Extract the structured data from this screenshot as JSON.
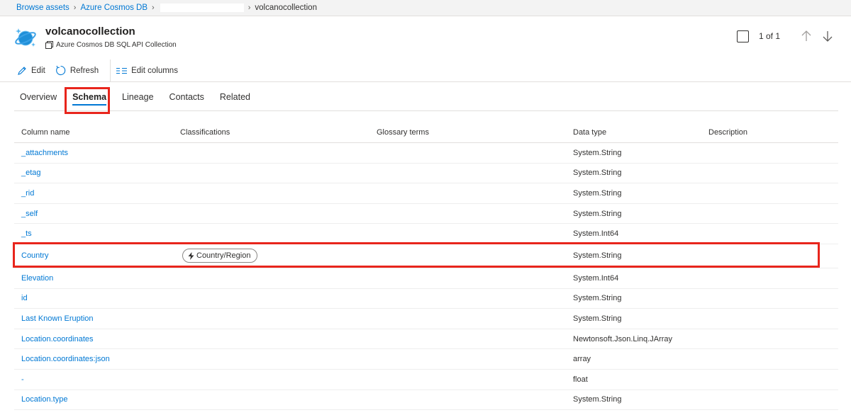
{
  "breadcrumb": {
    "items": [
      "Browse assets",
      "Azure Cosmos DB"
    ],
    "current": "volcanocollection"
  },
  "asset": {
    "title": "volcanocollection",
    "subtitle": "Azure Cosmos DB SQL API Collection",
    "icon": "cosmos-db-icon"
  },
  "pager": {
    "text": "1 of 1"
  },
  "toolbar": {
    "edit_label": "Edit",
    "refresh_label": "Refresh",
    "edit_columns_label": "Edit columns"
  },
  "tabs": [
    {
      "label": "Overview"
    },
    {
      "label": "Schema",
      "active": true
    },
    {
      "label": "Lineage"
    },
    {
      "label": "Contacts"
    },
    {
      "label": "Related"
    }
  ],
  "table": {
    "headers": [
      "Column name",
      "Classifications",
      "Glossary terms",
      "Data type",
      "Description"
    ],
    "rows": [
      {
        "name": "_attachments",
        "classification": "",
        "type": "System.String"
      },
      {
        "name": "_etag",
        "classification": "",
        "type": "System.String"
      },
      {
        "name": "_rid",
        "classification": "",
        "type": "System.String"
      },
      {
        "name": "_self",
        "classification": "",
        "type": "System.String"
      },
      {
        "name": "_ts",
        "classification": "",
        "type": "System.Int64"
      },
      {
        "name": "Country",
        "classification": "Country/Region",
        "type": "System.String"
      },
      {
        "name": "Elevation",
        "classification": "",
        "type": "System.Int64"
      },
      {
        "name": "id",
        "classification": "",
        "type": "System.String"
      },
      {
        "name": "Last Known Eruption",
        "classification": "",
        "type": "System.String"
      },
      {
        "name": "Location.coordinates",
        "classification": "",
        "type": "Newtonsoft.Json.Linq.JArray"
      },
      {
        "name": "Location.coordinates:json",
        "classification": "",
        "type": "array"
      },
      {
        "name": "-",
        "classification": "",
        "type": "float"
      },
      {
        "name": "Location.type",
        "classification": "",
        "type": "System.String"
      }
    ]
  },
  "colors": {
    "accent": "#0078d4",
    "highlight": "#e8251c"
  }
}
